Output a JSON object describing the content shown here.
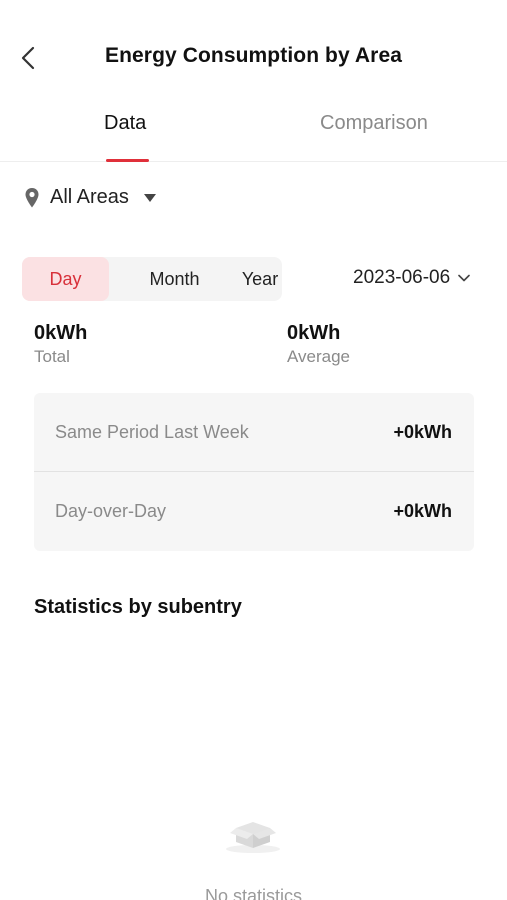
{
  "header": {
    "title": "Energy Consumption by Area",
    "back_icon": "chevron-left-icon"
  },
  "tabs": {
    "data_label": "Data",
    "comparison_label": "Comparison",
    "active": "Data",
    "accent_color": "#e0303a"
  },
  "area_filter": {
    "label": "All Areas",
    "icon": "location-pin-icon",
    "dropdown_icon": "caret-down-icon"
  },
  "period": {
    "options": [
      "Day",
      "Month",
      "Year"
    ],
    "selected": "Day",
    "date": "2023-06-06"
  },
  "summary": {
    "total_value": "0kWh",
    "total_label": "Total",
    "average_value": "0kWh",
    "average_label": "Average"
  },
  "comparison": {
    "rows": [
      {
        "label": "Same Period Last Week",
        "value": "+0kWh"
      },
      {
        "label": "Day-over-Day",
        "value": "+0kWh"
      }
    ]
  },
  "statistics": {
    "title": "Statistics by subentry",
    "empty_text": "No statistics",
    "empty_icon": "empty-box-icon"
  }
}
